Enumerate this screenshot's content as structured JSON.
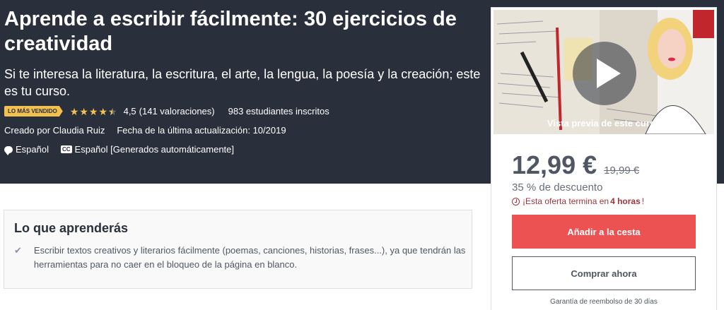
{
  "course": {
    "title": "Aprende a escribir fácilmente: 30 ejercicios de creatividad",
    "subtitle": "Si te interesa la literatura, la escritura, el arte, la lengua, la poesía y la creación; este es tu curso.",
    "badge": "LO MÁS VENDIDO",
    "rating_stars": 4.5,
    "rating_value": "4,5",
    "rating_count": "(141 valoraciones)",
    "students": "983 estudiantes inscritos",
    "created_by": "Creado por Claudia Ruiz",
    "last_update": "Fecha de la última actualización: 10/2019",
    "language": "Español",
    "captions": "Español [Generados automáticamente]",
    "caption_icon_text": "CC"
  },
  "card": {
    "preview_label": "Vista previa de este curso",
    "price": "12,99 €",
    "old_price": "19,99 €",
    "discount": "35 % de descuento",
    "offer_prefix": "¡Esta oferta termina en",
    "offer_hours": "4 horas",
    "offer_suffix": "!",
    "add_to_cart": "Añadir a la cesta",
    "buy_now": "Comprar ahora",
    "guarantee": "Garantía de reembolso de 30 días"
  },
  "learn": {
    "title": "Lo que aprenderás",
    "items": [
      "Escribir textos creativos y literarios fácilmente (poemas, canciones, historias, frases...), ya que tendrán las herramientas para no caer en el bloqueo de la página en blanco."
    ]
  },
  "colors": {
    "hero_bg": "#29303b",
    "badge": "#f4c150",
    "cart_button": "#ec5252",
    "offer_text": "#a1353e"
  },
  "icons": [
    "star-icon",
    "speech-bubble-icon",
    "cc-icon",
    "play-icon",
    "clock-icon",
    "check-icon"
  ]
}
